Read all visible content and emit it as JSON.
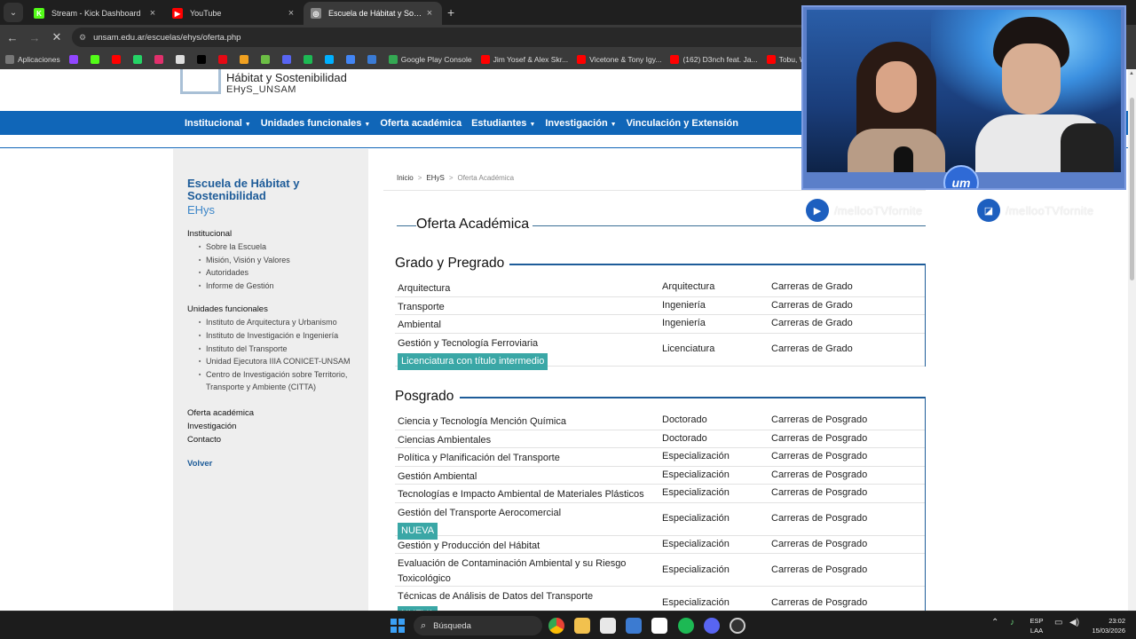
{
  "browser": {
    "tabs": [
      {
        "title": "Stream - Kick Dashboard",
        "color": "#53fc18",
        "glyph": "K",
        "active": false
      },
      {
        "title": "YouTube",
        "color": "#ff0000",
        "glyph": "▶",
        "active": false
      },
      {
        "title": "Escuela de Hábitat y Sostenibili...",
        "color": "#888888",
        "glyph": "◎",
        "active": true
      }
    ],
    "new_tab": "+",
    "url": "unsam.edu.ar/escuelas/ehys/oferta.php",
    "bookmarks": [
      {
        "label": "Aplicaciones",
        "color": "#777777"
      },
      {
        "label": "",
        "color": "#9146ff"
      },
      {
        "label": "",
        "color": "#53fc18"
      },
      {
        "label": "",
        "color": "#ff0000"
      },
      {
        "label": "",
        "color": "#25d366"
      },
      {
        "label": "",
        "color": "#e1306c"
      },
      {
        "label": "",
        "color": "#dddddd"
      },
      {
        "label": "",
        "color": "#000000"
      },
      {
        "label": "",
        "color": "#e50914"
      },
      {
        "label": "",
        "color": "#f0a020"
      },
      {
        "label": "",
        "color": "#6cbe45"
      },
      {
        "label": "",
        "color": "#5865f2"
      },
      {
        "label": "",
        "color": "#1db954"
      },
      {
        "label": "",
        "color": "#00b0ff"
      },
      {
        "label": "",
        "color": "#4285f4"
      },
      {
        "label": "",
        "color": "#3a7bd5"
      },
      {
        "label": "Google Play Console",
        "color": "#34a853"
      },
      {
        "label": "Jim Yosef & Alex Skr...",
        "color": "#ff0000"
      },
      {
        "label": "Vicetone & Tony Igy...",
        "color": "#ff0000"
      },
      {
        "label": "(162) D3nch feat. Ja...",
        "color": "#ff0000"
      },
      {
        "label": "Tobu, Wi",
        "color": "#ff0000"
      }
    ]
  },
  "site": {
    "logo_line1": "Hábitat y Sostenibilidad",
    "logo_line2": "EHyS_UNSAM",
    "nav": [
      {
        "label": "Institucional",
        "dropdown": true
      },
      {
        "label": "Unidades funcionales",
        "dropdown": true
      },
      {
        "label": "Oferta académica",
        "dropdown": false
      },
      {
        "label": "Estudiantes",
        "dropdown": true
      },
      {
        "label": "Investigación",
        "dropdown": true
      },
      {
        "label": "Vinculación y Extensión",
        "dropdown": false
      }
    ],
    "caret": "▼"
  },
  "sidebar": {
    "title": "Escuela de Hábitat y Sostenibilidad",
    "subtitle": "EHys",
    "institucional": {
      "heading": "Institucional",
      "items": [
        "Sobre la Escuela",
        "Misión, Visión y Valores",
        "Autoridades",
        "Informe de Gestión"
      ]
    },
    "unidades": {
      "heading": "Unidades funcionales",
      "items": [
        "Instituto de Arquitectura y Urbanismo",
        "Instituto de Investigación e Ingeniería",
        "Instituto del Transporte",
        "Unidad Ejecutora IIIA CONICET-UNSAM",
        "Centro de Investigación sobre Territorio, Transporte y Ambiente (CITTA)"
      ]
    },
    "links": [
      "Oferta académica",
      "Investigación",
      "Contacto"
    ],
    "volver": "Volver"
  },
  "breadcrumb": {
    "items": [
      "Inicio",
      "EHyS"
    ],
    "current": "Oferta Académica",
    "sep": ">"
  },
  "main": {
    "title": "Oferta Académica",
    "grado": {
      "title": "Grado y Pregrado",
      "rows": [
        {
          "name": "Arquitectura",
          "badge": "",
          "type": "Arquitectura",
          "category": "Carreras de Grado"
        },
        {
          "name": "Transporte",
          "badge": "",
          "type": "Ingeniería",
          "category": "Carreras de Grado"
        },
        {
          "name": "Ambiental",
          "badge": "",
          "type": "Ingeniería",
          "category": "Carreras de Grado"
        },
        {
          "name": "Gestión y Tecnología Ferroviaria",
          "badge": "Licenciatura con título intermedio",
          "type": "Licenciatura",
          "category": "Carreras de Grado"
        }
      ]
    },
    "posgrado": {
      "title": "Posgrado",
      "rows": [
        {
          "name": "Ciencia y Tecnología Mención Química",
          "badge": "",
          "type": "Doctorado",
          "category": "Carreras de Posgrado"
        },
        {
          "name": "Ciencias Ambientales",
          "badge": "",
          "type": "Doctorado",
          "category": "Carreras de Posgrado"
        },
        {
          "name": "Política y Planificación del Transporte",
          "badge": "",
          "type": "Especialización",
          "category": "Carreras de Posgrado"
        },
        {
          "name": "Gestión Ambiental",
          "badge": "",
          "type": "Especialización",
          "category": "Carreras de Posgrado"
        },
        {
          "name": "Tecnologías e Impacto Ambiental de Materiales Plásticos",
          "badge": "",
          "type": "Especialización",
          "category": "Carreras de Posgrado"
        },
        {
          "name": "Gestión del Transporte Aerocomercial",
          "badge": "NUEVA",
          "type": "Especialización",
          "category": "Carreras de Posgrado"
        },
        {
          "name": "Gestión y Producción del Hábitat",
          "badge": "",
          "type": "Especialización",
          "category": "Carreras de Posgrado"
        },
        {
          "name": "Evaluación de Contaminación Ambiental y su Riesgo Toxicológico",
          "badge": "",
          "type": "Especialización",
          "category": "Carreras de Posgrado"
        },
        {
          "name": "Técnicas de Análisis de Datos del Transporte",
          "badge": "NUEVA",
          "type": "Especialización",
          "category": "Carreras de Posgrado"
        }
      ]
    }
  },
  "overlay": {
    "logo_text": "um",
    "youtube_handle": "/mellooTVfornite",
    "twitch_handle": "/mellooTVfornite"
  },
  "taskbar": {
    "search_label": "Búsqueda",
    "lang1": "ESP",
    "lang2": "LAA",
    "time": "23:02",
    "date": "15/03/2026"
  }
}
